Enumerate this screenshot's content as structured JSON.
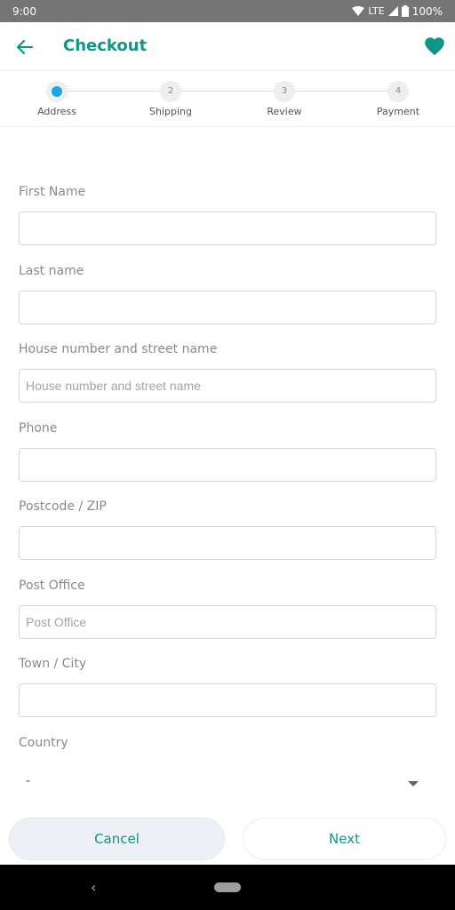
{
  "status_bar": {
    "time": "9:00",
    "network": "LTE",
    "battery": "100%"
  },
  "app_bar": {
    "title": "Checkout",
    "back_icon": "arrow-left-icon",
    "favorite_icon": "heart-icon"
  },
  "colors": {
    "accent": "#139488",
    "active_step": "#1aa6e2"
  },
  "stepper": {
    "current_step": 1,
    "steps": [
      {
        "number": "1",
        "label": "Address"
      },
      {
        "number": "2",
        "label": "Shipping"
      },
      {
        "number": "3",
        "label": "Review"
      },
      {
        "number": "4",
        "label": "Payment"
      }
    ]
  },
  "form": {
    "first_name": {
      "label": "First Name",
      "value": "",
      "placeholder": ""
    },
    "last_name": {
      "label": "Last name",
      "value": "",
      "placeholder": ""
    },
    "street": {
      "label": "House number and street name",
      "value": "",
      "placeholder": "House number and street name"
    },
    "phone": {
      "label": "Phone",
      "value": "",
      "placeholder": ""
    },
    "postcode": {
      "label": "Postcode / ZIP",
      "value": "",
      "placeholder": ""
    },
    "post_office": {
      "label": "Post Office",
      "value": "",
      "placeholder": "Post Office"
    },
    "town": {
      "label": "Town / City",
      "value": "",
      "placeholder": ""
    },
    "country": {
      "label": "Country",
      "selected": "-"
    }
  },
  "footer": {
    "cancel_label": "Cancel",
    "next_label": "Next"
  },
  "nav_bar": {
    "back_glyph": "‹"
  }
}
